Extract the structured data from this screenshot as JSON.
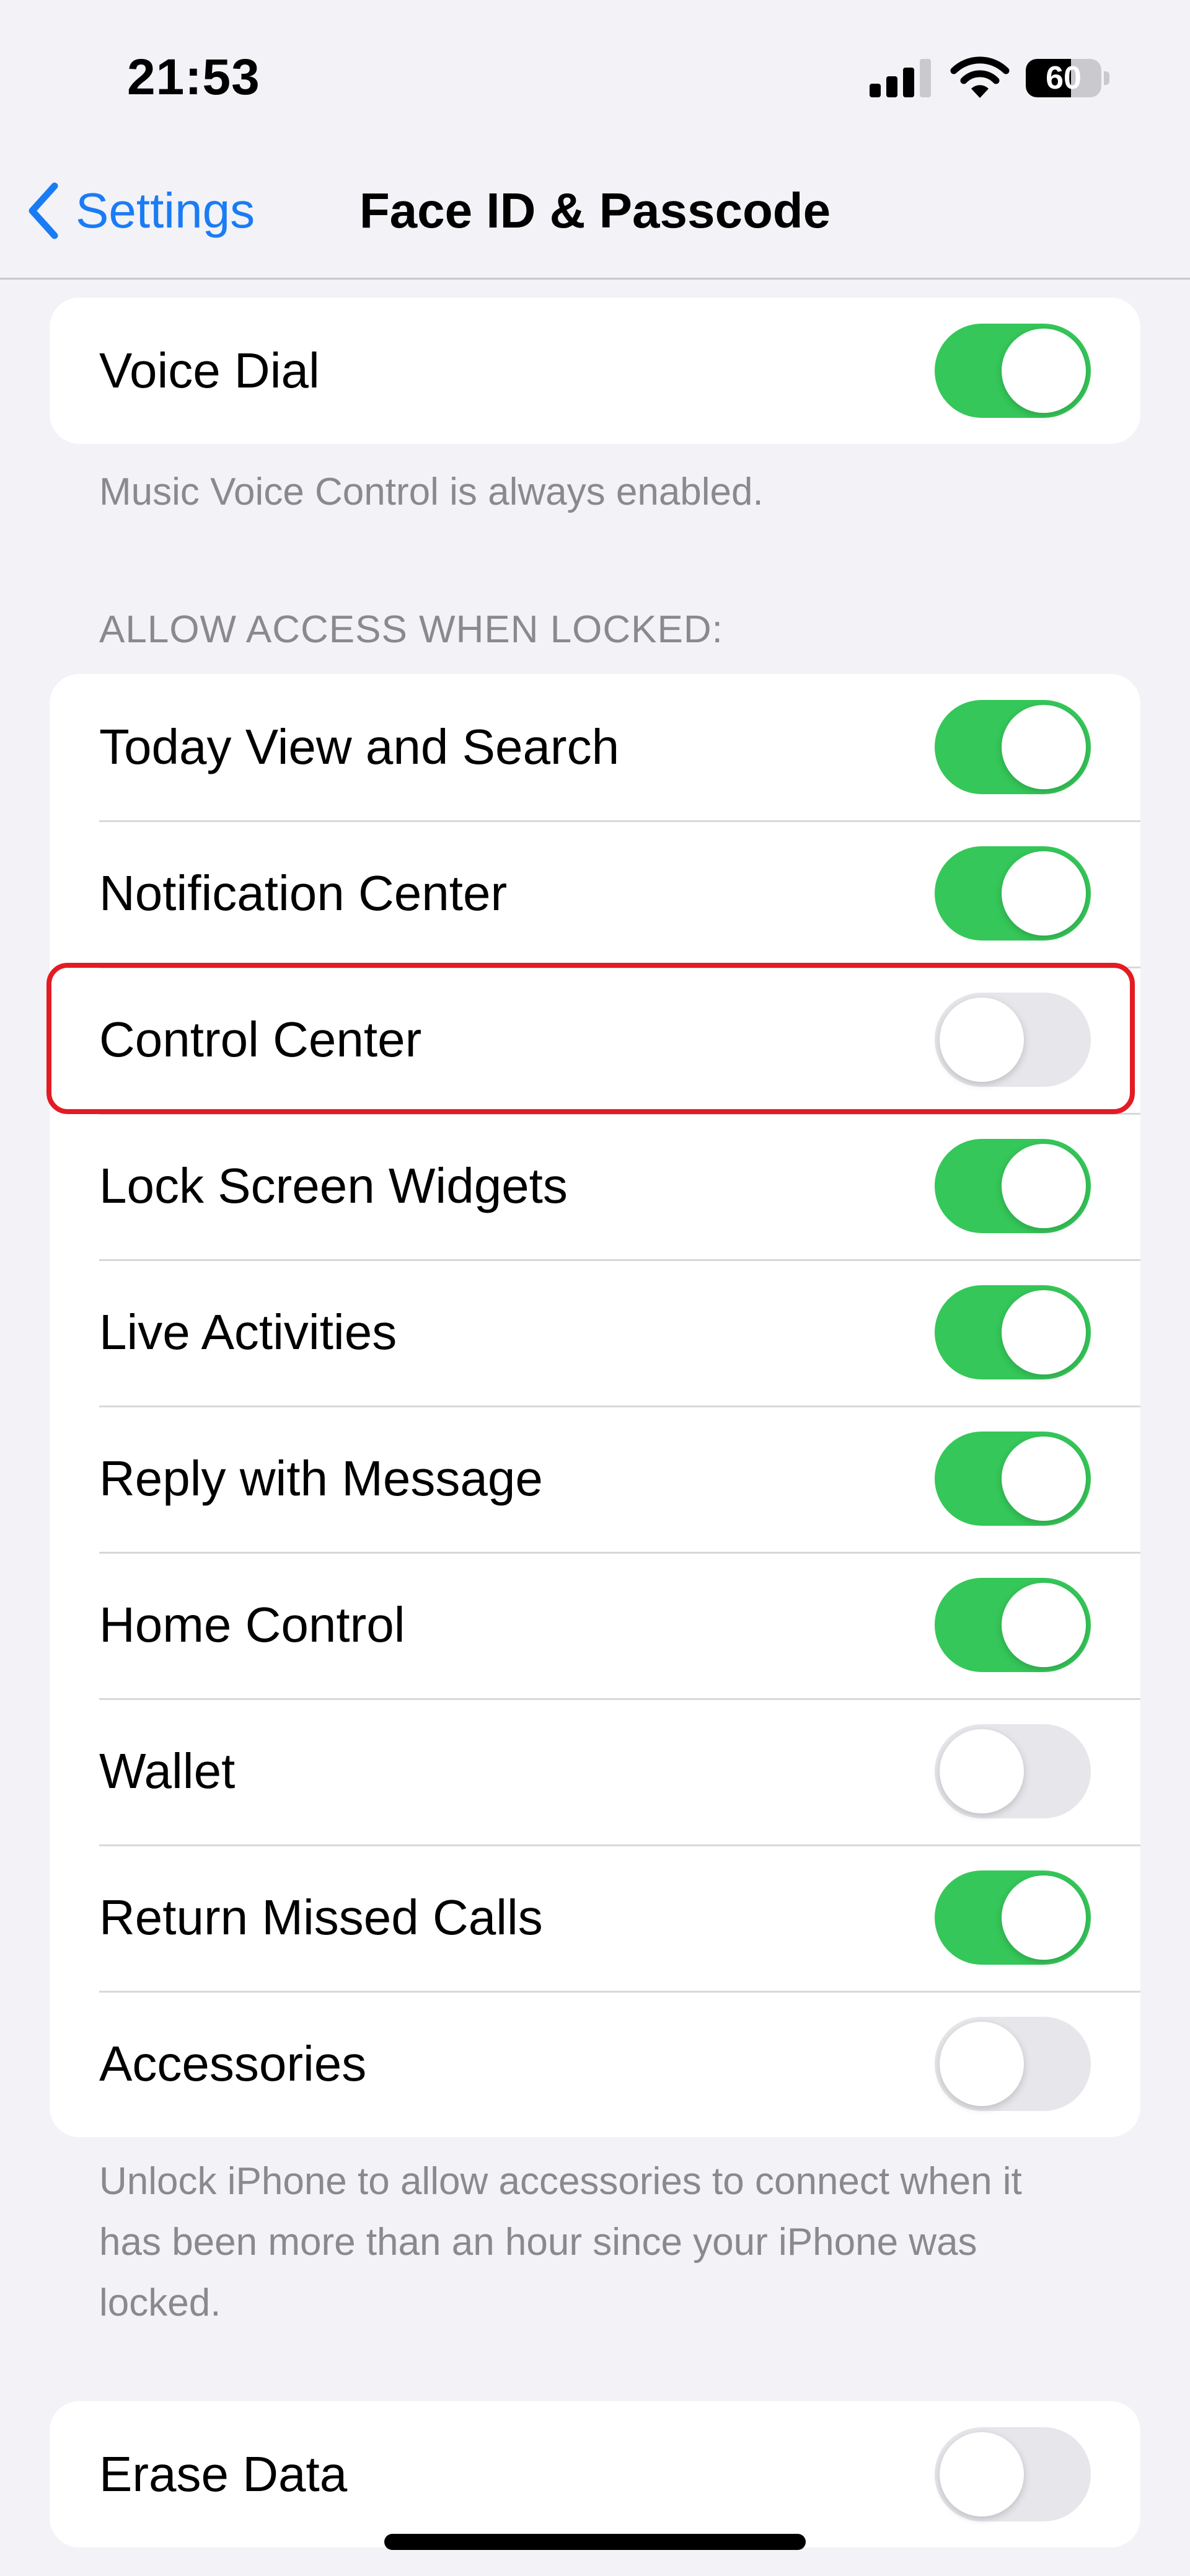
{
  "status_bar": {
    "time": "21:53",
    "battery_level": "60",
    "battery_percent": 60
  },
  "nav": {
    "back_label": "Settings",
    "title": "Face ID & Passcode"
  },
  "voice_dial": {
    "label": "Voice Dial",
    "on": true,
    "footer": "Music Voice Control is always enabled."
  },
  "locked_access": {
    "header": "ALLOW ACCESS WHEN LOCKED:",
    "items": [
      {
        "label": "Today View and Search",
        "on": true
      },
      {
        "label": "Notification Center",
        "on": true
      },
      {
        "label": "Control Center",
        "on": false
      },
      {
        "label": "Lock Screen Widgets",
        "on": true
      },
      {
        "label": "Live Activities",
        "on": true
      },
      {
        "label": "Reply with Message",
        "on": true
      },
      {
        "label": "Home Control",
        "on": true
      },
      {
        "label": "Wallet",
        "on": false
      },
      {
        "label": "Return Missed Calls",
        "on": true
      },
      {
        "label": "Accessories",
        "on": false
      }
    ],
    "footer": "Unlock iPhone to allow accessories to connect when it has been more than an hour since your iPhone was locked."
  },
  "erase_data": {
    "label": "Erase Data",
    "on": false
  },
  "icons": {
    "back": "chevron-left-icon",
    "signal": "cellular-signal-icon",
    "wifi": "wifi-icon",
    "battery": "battery-icon"
  },
  "colors": {
    "accent": "#1a7cf5",
    "toggle_on": "#35c759",
    "toggle_off": "#e6e6eb",
    "highlight": "#e31b23",
    "background": "#f2f2f7"
  }
}
